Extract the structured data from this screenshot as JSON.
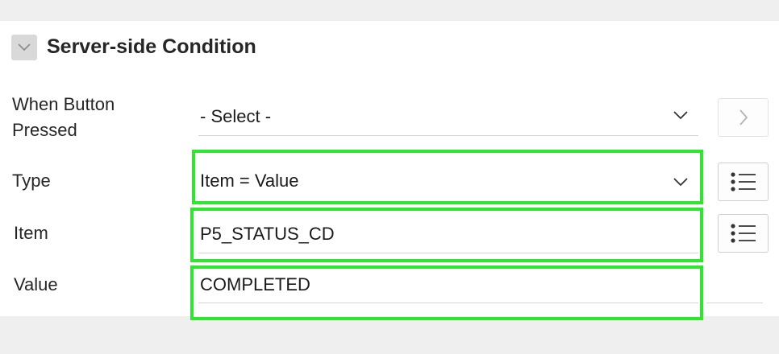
{
  "section": {
    "title": "Server-side Condition"
  },
  "fields": {
    "when_button_pressed": {
      "label_line1": "When Button",
      "label_line2": "Pressed",
      "value": "- Select -"
    },
    "type": {
      "label": "Type",
      "value": "Item = Value"
    },
    "item": {
      "label": "Item",
      "value": "P5_STATUS_CD"
    },
    "value": {
      "label": "Value",
      "value": "COMPLETED"
    }
  },
  "colors": {
    "highlight": "#2ee62e",
    "panel": "#ffffff",
    "background": "#efefef"
  },
  "icons": {
    "collapse": "chevron-down-icon",
    "go_to_button": "chevron-right-icon",
    "list": "list-icon"
  }
}
